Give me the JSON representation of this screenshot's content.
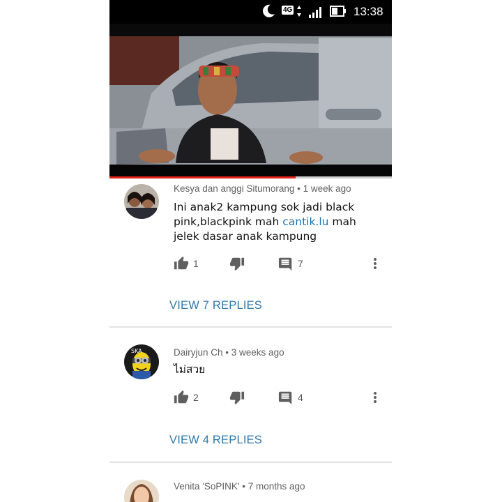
{
  "status_bar": {
    "network": "4G",
    "time": "13:38"
  },
  "video": {
    "progress_fraction": 0.66
  },
  "comments": [
    {
      "author": "Kesya dan anggi Situmorang",
      "age": "1 week ago",
      "text_before_link": "Ini anak2 kampung sok jadi black pink,blackpink mah ",
      "link": "cantik.lu",
      "text_after_link": " mah jelek dasar anak kampung",
      "likes": "1",
      "reply_count": "7",
      "view_replies": "VIEW 7 REPLIES"
    },
    {
      "author": "Dairyjun Ch",
      "age": "3 weeks ago",
      "text": "ไม่สวย",
      "likes": "2",
      "reply_count": "4",
      "view_replies": "VIEW 4 REPLIES"
    },
    {
      "author": "Venita 'SoPINK'",
      "age": "7 months ago"
    }
  ],
  "icons": {
    "like": "thumbs-up-icon",
    "dislike": "thumbs-down-icon",
    "reply": "comment-icon",
    "more": "more-vert-icon"
  },
  "colors": {
    "link": "#1a73b8",
    "replies_link": "#3077a8",
    "progress": "#e62117"
  }
}
